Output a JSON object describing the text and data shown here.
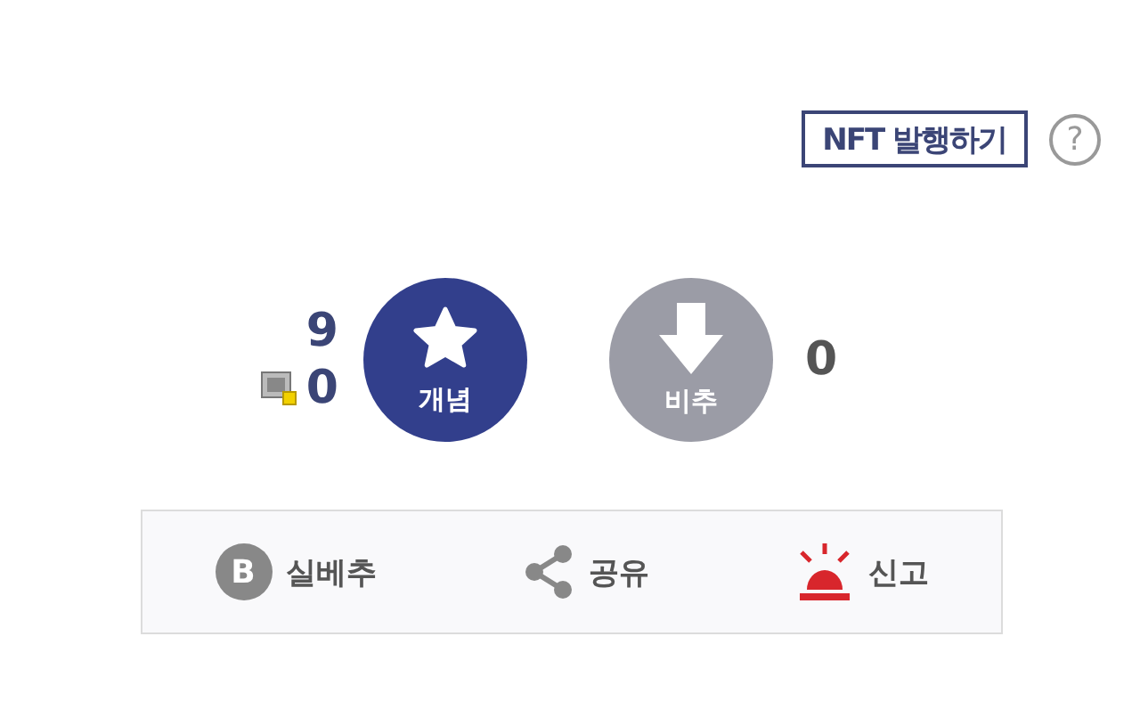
{
  "nft_button": {
    "label": "NFT 발행하기"
  },
  "help": {
    "label": "?"
  },
  "votes": {
    "up_count": "9",
    "fixed_count": "0",
    "up_label": "개념",
    "down_label": "비추",
    "down_count": "0"
  },
  "actions": [
    {
      "kind": "badge",
      "badge": "B",
      "label": "실베추"
    },
    {
      "kind": "share",
      "label": "공유"
    },
    {
      "kind": "report",
      "label": "신고"
    }
  ]
}
